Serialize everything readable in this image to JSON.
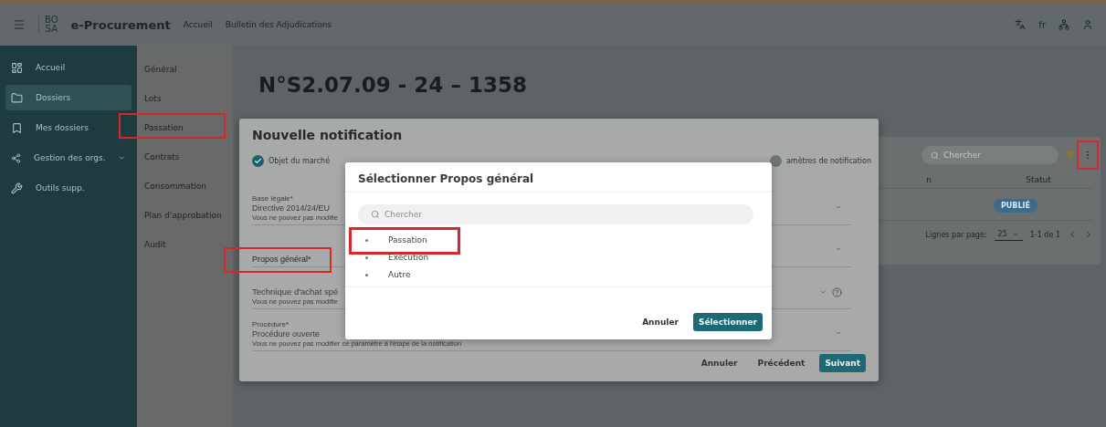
{
  "top_bar": {
    "logo_top": "BO",
    "logo_bottom": "SA",
    "app_name": "e-Procurement",
    "links": [
      "Accueil",
      "Bulletin des Adjudications"
    ],
    "language": "fr"
  },
  "sidebar": {
    "items": [
      {
        "label": "Accueil",
        "kind": "dashboard",
        "selected": false,
        "expandable": false
      },
      {
        "label": "Dossiers",
        "kind": "folder",
        "selected": true,
        "expandable": false
      },
      {
        "label": "Mes dossiers",
        "kind": "bookmark",
        "selected": false,
        "expandable": false
      },
      {
        "label": "Gestion des orgs.",
        "kind": "org",
        "selected": false,
        "expandable": true
      },
      {
        "label": "Outils supp.",
        "kind": "tools",
        "selected": false,
        "expandable": false
      }
    ]
  },
  "sub_nav": {
    "items": [
      {
        "label": "Général",
        "highlighted": false
      },
      {
        "label": "Lots",
        "highlighted": false
      },
      {
        "label": "Passation",
        "highlighted": true
      },
      {
        "label": "Contrats",
        "highlighted": false
      },
      {
        "label": "Consommation",
        "highlighted": false
      },
      {
        "label": "Plan d'approbation",
        "highlighted": false
      },
      {
        "label": "Audit",
        "highlighted": false
      }
    ]
  },
  "page": {
    "title": "N°S2.07.09 - 24 – 1358"
  },
  "table_card": {
    "search_placeholder": "Chercher",
    "menu_highlighted": true,
    "columns": [
      "n",
      "Statut"
    ],
    "rows": [
      {
        "status": "PUBLIÉ"
      }
    ],
    "pagination": {
      "rows_per_page_label": "Lignes par page:",
      "rows_per_page": "25",
      "range": "1-1 de 1"
    }
  },
  "notification_dialog": {
    "title": "Nouvelle notification",
    "steps": [
      {
        "label": "Objet du marché",
        "done": true
      },
      {
        "label": "amètres de notification",
        "done": false
      }
    ],
    "fields": [
      {
        "label": "Base légale*",
        "value": "Directive 2014/24/EU",
        "helper": "Vous ne pouvez pas modifie",
        "highlighted": false,
        "help": false
      },
      {
        "label": "Propos général*",
        "highlighted": true,
        "help": false
      },
      {
        "value": "Technique d'achat spé",
        "helper": "Vous ne pouvez pas modifie",
        "highlighted": false,
        "help": true
      },
      {
        "label": "Procédure*",
        "value": "Procédure ouverte",
        "helper": "Vous ne pouvez pas modifier ce paramètre à l'étape de la notification",
        "highlighted": false,
        "help": false
      }
    ],
    "buttons": [
      {
        "label": "Annuler",
        "kind": "text"
      },
      {
        "label": "Précédent",
        "kind": "text"
      },
      {
        "label": "Suivant",
        "kind": "primary"
      }
    ]
  },
  "select_dialog": {
    "title": "Sélectionner Propos général",
    "search_placeholder": "Chercher",
    "options": [
      {
        "label": "Passation",
        "highlighted": true
      },
      {
        "label": "Exécution",
        "highlighted": false
      },
      {
        "label": "Autre",
        "highlighted": false
      }
    ],
    "buttons": [
      {
        "label": "Annuler",
        "kind": "text"
      },
      {
        "label": "Sélectionner",
        "kind": "primary"
      }
    ]
  }
}
